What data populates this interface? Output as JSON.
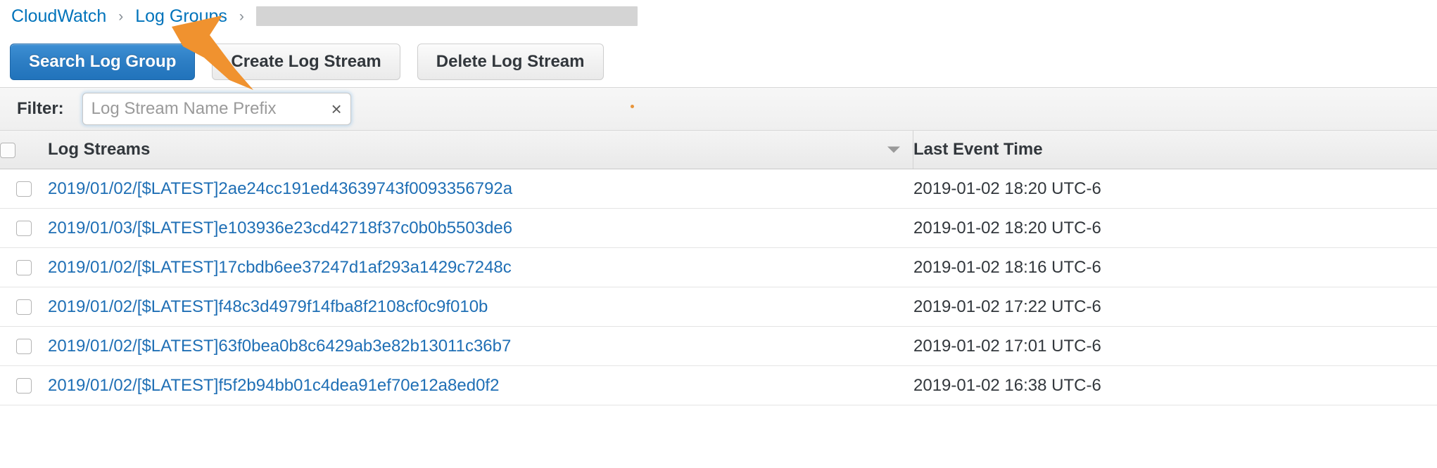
{
  "breadcrumb": {
    "items": [
      {
        "label": "CloudWatch",
        "type": "link"
      },
      {
        "label": "Log Groups",
        "type": "link"
      },
      {
        "label": "",
        "type": "redacted"
      }
    ],
    "separator": "›"
  },
  "toolbar": {
    "search_log_group_label": "Search Log Group",
    "create_log_stream_label": "Create Log Stream",
    "delete_log_stream_label": "Delete Log Stream"
  },
  "filter": {
    "label": "Filter:",
    "value": "",
    "placeholder": "Log Stream Name Prefix",
    "clear_glyph": "×"
  },
  "table": {
    "columns": {
      "name": "Log Streams",
      "time": "Last Event Time"
    },
    "sort": {
      "column": "Last Event Time",
      "direction": "descending"
    },
    "rows": [
      {
        "name": "2019/01/02/[$LATEST]2ae24cc191ed43639743f0093356792a",
        "time": "2019-01-02 18:20 UTC-6"
      },
      {
        "name": "2019/01/03/[$LATEST]e103936e23cd42718f37c0b0b5503de6",
        "time": "2019-01-02 18:20 UTC-6"
      },
      {
        "name": "2019/01/02/[$LATEST]17cbdb6ee37247d1af293a1429c7248c",
        "time": "2019-01-02 18:16 UTC-6"
      },
      {
        "name": "2019/01/02/[$LATEST]f48c3d4979f14fba8f2108cf0c9f010b",
        "time": "2019-01-02 17:22 UTC-6"
      },
      {
        "name": "2019/01/02/[$LATEST]63f0bea0b8c6429ab3e82b13011c36b7",
        "time": "2019-01-02 17:01 UTC-6"
      },
      {
        "name": "2019/01/02/[$LATEST]f5f2b94bb01c4dea91ef70e12a8ed0f2",
        "time": "2019-01-02 16:38 UTC-6"
      }
    ]
  },
  "annotation": {
    "arrow_color": "#f0922f",
    "points_at": "Create Log Stream"
  },
  "colors": {
    "link": "#0073bb",
    "primary_button": "#2d7ec4",
    "accent": "#f0922f"
  }
}
